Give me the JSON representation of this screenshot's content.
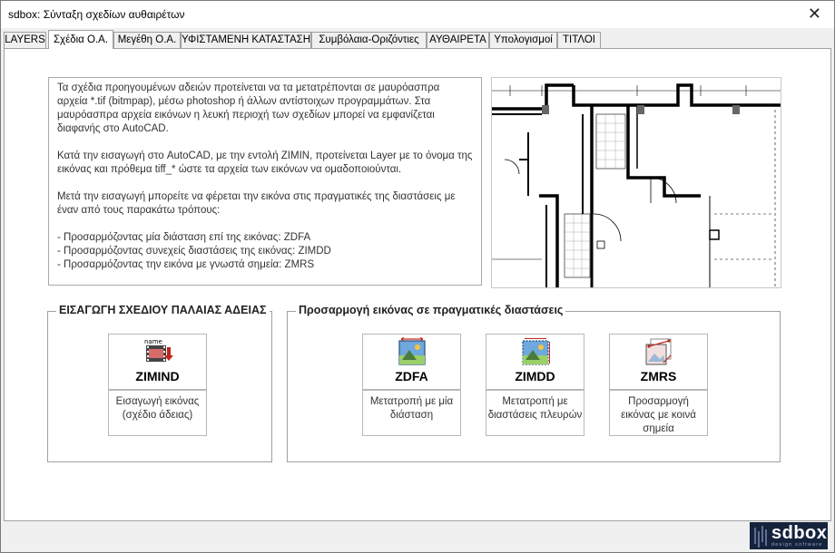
{
  "window": {
    "title": "sdbox: Σύνταξη σχεδίων αυθαιρέτων",
    "close_glyph": "✕"
  },
  "tabs": [
    {
      "label": "LAYERS"
    },
    {
      "label": "Σχέδια Ο.Α."
    },
    {
      "label": "Μεγέθη Ο.Α."
    },
    {
      "label": "ΥΦΙΣΤΑΜΕΝΗ ΚΑΤΑΣΤΑΣΗ"
    },
    {
      "label": "Συμβόλαια-Οριζόντιες"
    },
    {
      "label": "ΑΥΘΑΙΡΕΤΑ"
    },
    {
      "label": "Υπολογισμοί"
    },
    {
      "label": "ΤΙΤΛΟΙ"
    }
  ],
  "active_tab": "Σχέδια Ο.Α.",
  "info": {
    "p1": "Τα σχέδια προηγουμένων αδειών προτείνεται να τα μετατρέπονται σε μαυρόασπρα αρχεία *.tif (bitmpap), μέσω photoshop ή άλλων αντίστοιχων προγραμμάτων. Στα μαυρόασπρα αρχεία εικόνων η λευκή περιοχή των σχεδίων μπορεί να εμφανίζεται διαφανής στο AutoCAD.",
    "p2": "Κατά την εισαγωγή στο AutoCAD, με την εντολή ZIMIN, προτείνεται Layer με το όνομα της εικόνας και πρόθεμα tiff_* ώστε τα αρχεία των εικόνων να ομαδοποιούνται.",
    "p3": "Μετά την εισαγωγή μπορείτε να φέρεται την εικόνα στις πραγματικές της διαστάσεις με έναν από τους παρακάτω τρόπους:",
    "line1": "- Προσαρμόζοντας μία διάσταση επί της εικόνας:      ZDFA",
    "line2": "- Προσαρμόζοντας συνεχείς διαστάσεις της εικόνας:  ZIMDD",
    "line3": "- Προσαρμόζοντας την εικόνα με γνωστά σημεία:     ZMRS"
  },
  "group_import": {
    "title": "ΕΙΣΑΓΩΓΗ ΣΧΕΔΙΟΥ ΠΑΛΑΙΑΣ ΑΔΕΙΑΣ",
    "button": {
      "label": "ZIMIND",
      "icon": "film-import-icon",
      "icon_text": "name",
      "desc": "Εισαγωγή εικόνας (σχέδιο άδειας)"
    }
  },
  "group_adjust": {
    "title": "Προσαρμογή εικόνας σε πραγματικές διαστάσεις",
    "buttons": [
      {
        "label": "ZDFA",
        "icon": "image-dimension-icon",
        "desc": "Μετατροπή με μία διάσταση"
      },
      {
        "label": "ZIMDD",
        "icon": "image-dimensions-icon",
        "desc": "Μετατροπή με διαστάσεις πλευρών"
      },
      {
        "label": "ZMRS",
        "icon": "image-points-icon",
        "desc": "Προσαρμογή εικόνας με κοινά σημεία"
      }
    ]
  },
  "logo": {
    "name": "sdbox",
    "tagline": "design software"
  },
  "colors": {
    "logo_bg": "#16233d",
    "tab_active_bg": "#ffffff",
    "border": "#a0a0a0"
  }
}
